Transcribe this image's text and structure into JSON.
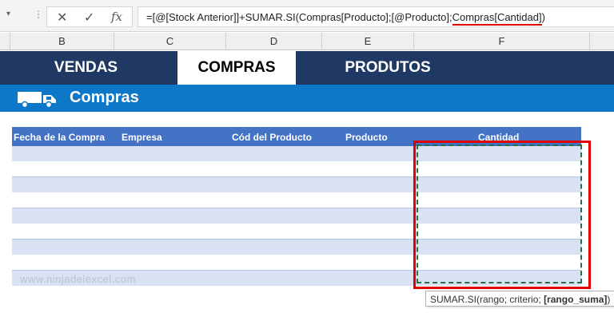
{
  "formula_bar": {
    "cancel_icon": "✕",
    "enter_icon": "✓",
    "fx_icon": "fx",
    "formula_prefix": "=[@[Stock Anterior]]+SUMAR.SI(Compras[Producto];[@Producto];",
    "formula_highlight": "Compras[Cantidad]",
    "formula_suffix": ")"
  },
  "column_headers": [
    "B",
    "C",
    "D",
    "E",
    "F"
  ],
  "nav": {
    "tabs": [
      "VENDAS",
      "COMPRAS",
      "PRODUTOS"
    ],
    "active": "COMPRAS"
  },
  "section": {
    "icon": "truck-icon",
    "title": "Compras"
  },
  "table": {
    "headers": [
      "Fecha de la Compra",
      "Empresa",
      "Cód del Producto",
      "Producto",
      "Cantidad"
    ],
    "row_count": 9
  },
  "watermark": "www.ninjadelexcel.com",
  "tooltip": {
    "function": "SUMAR.SI(",
    "args": "rango; criterio; ",
    "bold_arg": "[rango_suma]",
    "close": ")"
  },
  "colors": {
    "nav_bg": "#1f3864",
    "section_bg": "#0e78c8",
    "table_header": "#4472c4",
    "band_row": "#d9e1f2",
    "highlight_red": "#e00000",
    "selection_green": "#217346"
  }
}
